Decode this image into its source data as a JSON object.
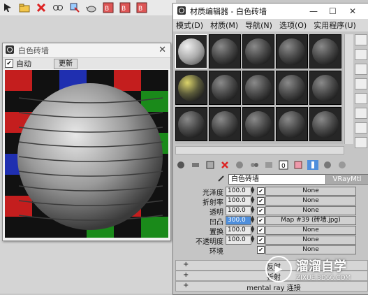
{
  "toolbar": {
    "icons": [
      "pointer-icon",
      "folder-icon",
      "close-x-icon",
      "link-icon",
      "bind-icon",
      "teapot-icon",
      "map-icon",
      "map-icon",
      "map-icon"
    ]
  },
  "preview": {
    "title": "白色砖墙",
    "auto_label": "自动",
    "update_label": "更新"
  },
  "editor": {
    "title": "材质编辑器 - 白色砖墙",
    "menu": [
      "模式(D)",
      "材质(M)",
      "导航(N)",
      "选项(O)",
      "实用程序(U)"
    ],
    "material_name": "白色砖墙",
    "material_type": "VRayMtl",
    "params": [
      {
        "label": "光泽度",
        "value": "100.0",
        "checked": "✔",
        "map": "None"
      },
      {
        "label": "折射率",
        "value": "100.0",
        "checked": "✔",
        "map": "None"
      },
      {
        "label": "透明",
        "value": "100.0",
        "checked": "✔",
        "map": "None"
      },
      {
        "label": "凹凸",
        "value": "300.0",
        "checked": "✔",
        "map": "Map #39 (砖墙.jpg)"
      },
      {
        "label": "置换",
        "value": "100.0",
        "checked": "✔",
        "map": "None"
      },
      {
        "label": "不透明度",
        "value": "100.0",
        "checked": "✔",
        "map": "None"
      },
      {
        "label": "环境",
        "value": "",
        "checked": "✔",
        "map": "None"
      }
    ],
    "rollouts": [
      {
        "sign": "+",
        "label": "反射"
      },
      {
        "sign": "+",
        "label": "折射"
      },
      {
        "sign": "+",
        "label": "mental ray 连接"
      }
    ]
  },
  "watermark": {
    "brand": "溜溜自学",
    "url": "ZIXUE.3D66.COM"
  },
  "colors": {
    "selection": "#4f8fdc",
    "slot_bg": "#262626"
  }
}
